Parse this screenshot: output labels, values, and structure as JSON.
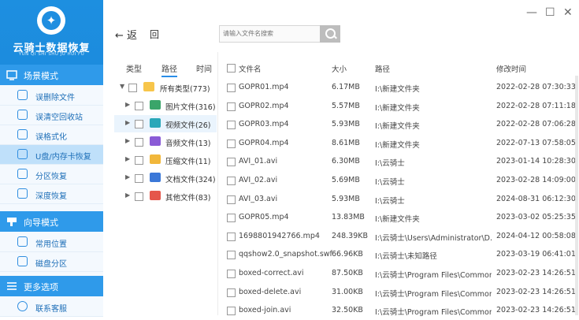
{
  "app": {
    "name": "云骑士数据恢复",
    "subtitle": "YUN QI SHI SHU JU HUI FU"
  },
  "sidebar": {
    "sections": [
      {
        "label": "场景模式",
        "items": [
          {
            "label": "误删除文件"
          },
          {
            "label": "误清空回收站"
          },
          {
            "label": "误格式化"
          },
          {
            "label": "U盘/内存卡恢复"
          },
          {
            "label": "分区恢复"
          },
          {
            "label": "深度恢复"
          }
        ]
      },
      {
        "label": "向导模式",
        "items": [
          {
            "label": "常用位置"
          },
          {
            "label": "磁盘分区"
          }
        ]
      },
      {
        "label": "更多选项",
        "items": [
          {
            "label": "联系客服"
          }
        ]
      }
    ],
    "active_item": "U盘/内存卡恢复"
  },
  "toolbar": {
    "back_label": "返",
    "home_label": "回",
    "search_placeholder": "请输入文件名搜索"
  },
  "tree": {
    "tabs": [
      "类型",
      "路径",
      "时间"
    ],
    "active_tab": "路径",
    "rows": [
      {
        "label": "所有类型(773)",
        "icon": "folder-icon",
        "color": "#f7c54a"
      },
      {
        "label": "图片文件(316)",
        "icon": "image-icon",
        "color": "#3aa56a"
      },
      {
        "label": "视频文件(26)",
        "icon": "video-icon",
        "color": "#2aa7b9"
      },
      {
        "label": "音频文件(13)",
        "icon": "audio-icon",
        "color": "#8a5bd6"
      },
      {
        "label": "压缩文件(11)",
        "icon": "zip-icon",
        "color": "#f1b73b"
      },
      {
        "label": "文档文件(324)",
        "icon": "document-icon",
        "color": "#3b78d8"
      },
      {
        "label": "其他文件(83)",
        "icon": "other-icon",
        "color": "#e5574b"
      }
    ]
  },
  "list": {
    "headers": {
      "name": "文件名",
      "size": "大小",
      "path": "路径",
      "date": "修改时间"
    },
    "rows": [
      {
        "name": "GOPR01.mp4",
        "size": "6.17MB",
        "path": "I:\\新建文件夹",
        "date": "2022-02-28 07:30:33"
      },
      {
        "name": "GOPR02.mp4",
        "size": "5.57MB",
        "path": "I:\\新建文件夹",
        "date": "2022-02-28 07:11:18"
      },
      {
        "name": "GOPR03.mp4",
        "size": "5.93MB",
        "path": "I:\\新建文件夹",
        "date": "2022-02-28 07:06:28"
      },
      {
        "name": "GOPR04.mp4",
        "size": "8.61MB",
        "path": "I:\\新建文件夹",
        "date": "2022-07-13 07:58:05"
      },
      {
        "name": "AVI_01.avi",
        "size": "6.30MB",
        "path": "I:\\云骑士",
        "date": "2023-01-14 10:28:30"
      },
      {
        "name": "AVI_02.avi",
        "size": "5.69MB",
        "path": "I:\\云骑士",
        "date": "2023-02-28 14:09:00"
      },
      {
        "name": "AVI_03.avi",
        "size": "5.93MB",
        "path": "I:\\云骑士",
        "date": "2024-08-31 06:12:30"
      },
      {
        "name": "GOPR05.mp4",
        "size": "13.83MB",
        "path": "I:\\新建文件夹",
        "date": "2023-03-02 05:25:35"
      },
      {
        "name": "1698801942766.mp4",
        "size": "248.39KB",
        "path": "I:\\云骑士\\Users\\Administrator\\D...",
        "date": "2024-04-12 00:58:08"
      },
      {
        "name": "qqshow2.0_snapshot.swf",
        "size": "66.96KB",
        "path": "I:\\云骑士\\未知路径",
        "date": "2023-03-19 06:41:01"
      },
      {
        "name": "boxed-correct.avi",
        "size": "87.50KB",
        "path": "I:\\云骑士\\Program Files\\Common...",
        "date": "2023-02-23 14:26:51"
      },
      {
        "name": "boxed-delete.avi",
        "size": "31.00KB",
        "path": "I:\\云骑士\\Program Files\\Common...",
        "date": "2023-02-23 14:26:51"
      },
      {
        "name": "boxed-join.avi",
        "size": "32.50KB",
        "path": "I:\\云骑士\\Program Files\\Common...",
        "date": "2023-02-23 14:26:51"
      }
    ]
  },
  "colors": {
    "accent": "#1d8fe0",
    "sidebar_bg": "#f4f9fe",
    "active_item": "#bfe0fa"
  }
}
